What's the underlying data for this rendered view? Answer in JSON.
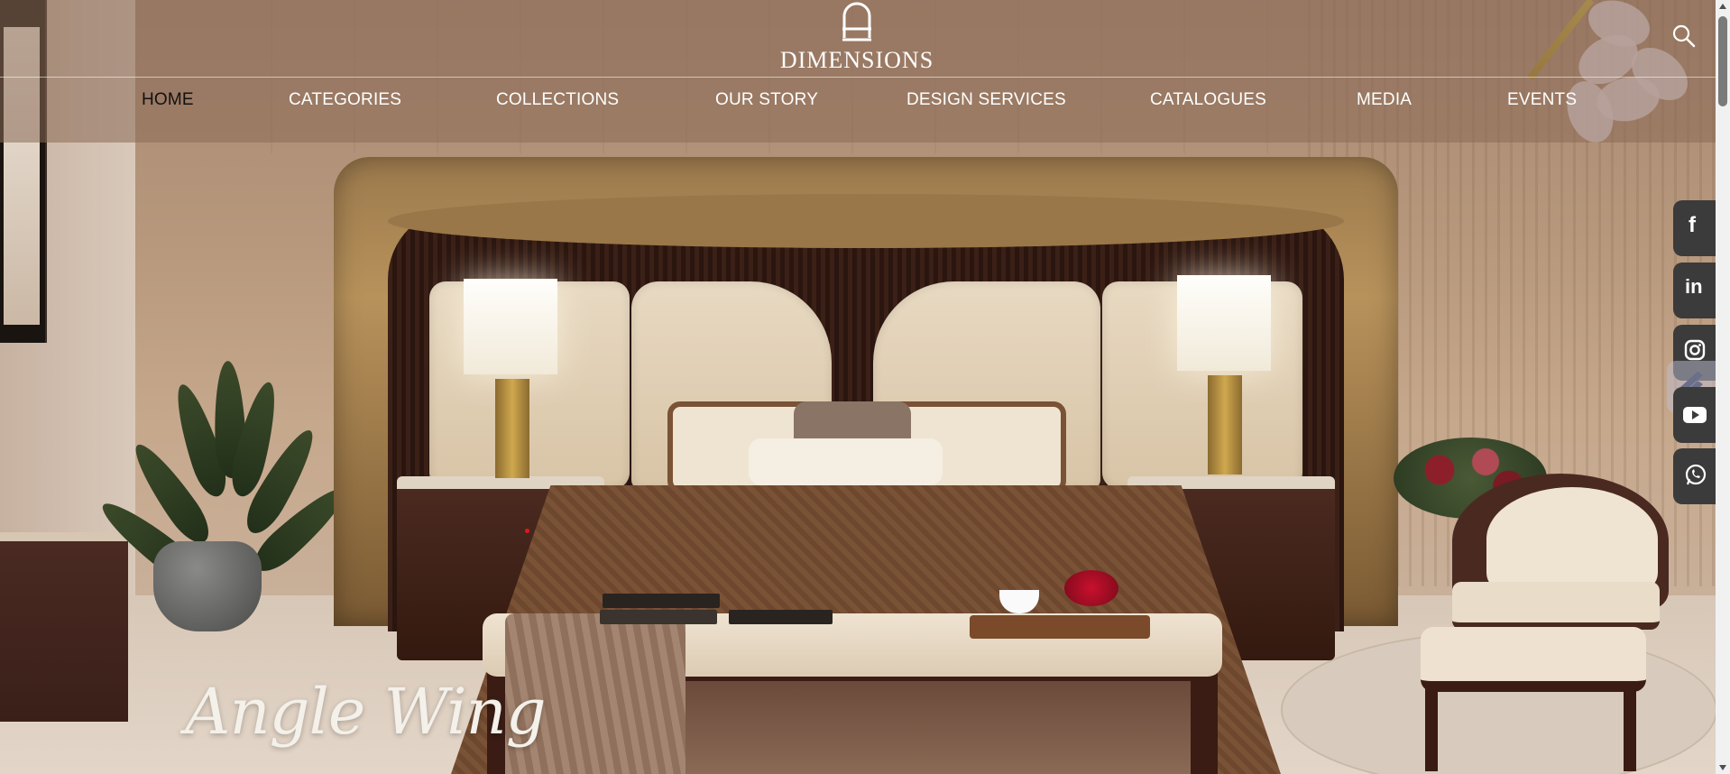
{
  "brand": {
    "name": "DIMENSIONS"
  },
  "nav": {
    "items": [
      {
        "label": "HOME",
        "active": true
      },
      {
        "label": "CATEGORIES"
      },
      {
        "label": "COLLECTIONS"
      },
      {
        "label": "OUR STORY"
      },
      {
        "label": "DESIGN SERVICES"
      },
      {
        "label": "CATALOGUES"
      },
      {
        "label": "MEDIA"
      },
      {
        "label": "EVENTS"
      }
    ]
  },
  "hero": {
    "caption": "Angle Wing"
  },
  "social": {
    "items": [
      {
        "icon": "facebook-icon",
        "glyph": "f"
      },
      {
        "icon": "linkedin-icon",
        "glyph": "in"
      },
      {
        "icon": "instagram-icon"
      },
      {
        "icon": "youtube-icon"
      },
      {
        "icon": "whatsapp-icon"
      }
    ]
  },
  "colors": {
    "active_nav": "#111111",
    "nav_text": "#ffffff",
    "social_bg": "#3b3b3b"
  }
}
